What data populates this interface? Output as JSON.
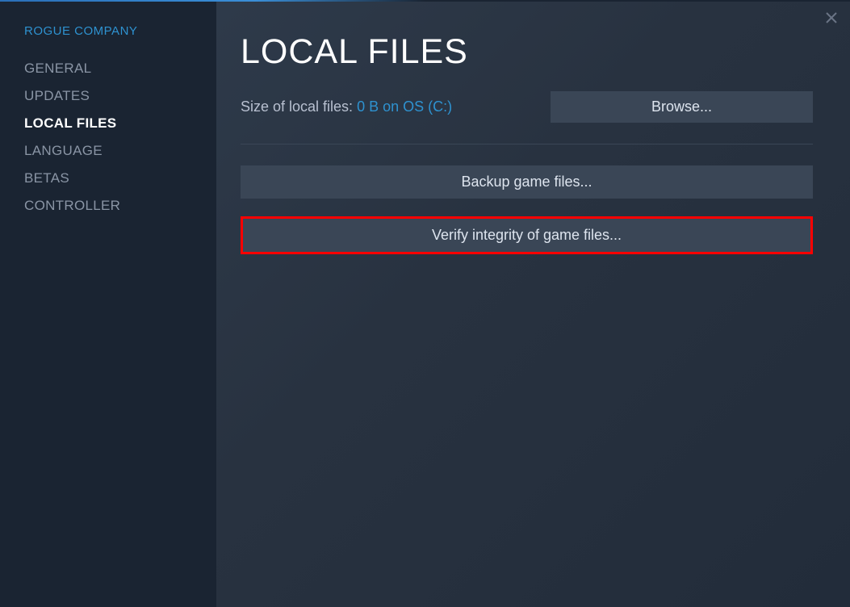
{
  "game_title": "ROGUE COMPANY",
  "sidebar": {
    "items": [
      {
        "label": "GENERAL"
      },
      {
        "label": "UPDATES"
      },
      {
        "label": "LOCAL FILES"
      },
      {
        "label": "LANGUAGE"
      },
      {
        "label": "BETAS"
      },
      {
        "label": "CONTROLLER"
      }
    ]
  },
  "main": {
    "title": "LOCAL FILES",
    "size_label": "Size of local files: ",
    "size_value": "0 B on OS (C:)",
    "browse_label": "Browse...",
    "backup_label": "Backup game files...",
    "verify_label": "Verify integrity of game files..."
  }
}
